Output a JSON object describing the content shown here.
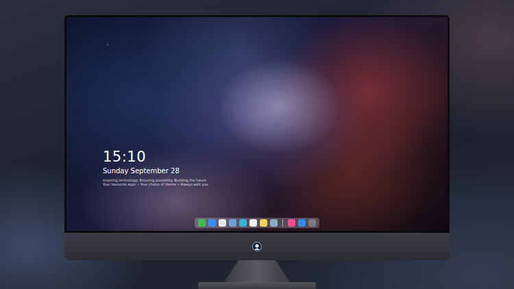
{
  "screen": {
    "clock": {
      "time": "15:10",
      "date": "Sunday September 28",
      "lines": [
        "Inspiring technology. Ensuring possibility. Building the future",
        "Your favourite apps • Your choice of theme • Always with you"
      ]
    },
    "dock": {
      "items": [
        {
          "kind": "app",
          "color": "#3fc24d"
        },
        {
          "kind": "app",
          "color": "#3a8ef0"
        },
        {
          "kind": "app",
          "color": "#e6e6e6"
        },
        {
          "kind": "app",
          "color": "#6aa2d8"
        },
        {
          "kind": "app",
          "color": "#2fb8d8"
        },
        {
          "kind": "app",
          "color": "#f2f2f2"
        },
        {
          "kind": "app",
          "color": "#f5d04c"
        },
        {
          "kind": "app",
          "color": "#8ab0c8"
        },
        {
          "kind": "separator",
          "color": "#ffffff"
        },
        {
          "kind": "app",
          "color": "#f04c8c"
        },
        {
          "kind": "app",
          "color": "#2a8ef5"
        },
        {
          "kind": "app",
          "color": "#7a7a80"
        }
      ]
    }
  }
}
